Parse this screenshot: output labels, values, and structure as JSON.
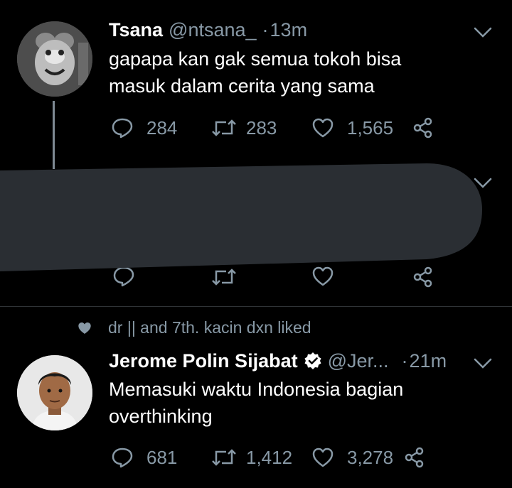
{
  "tweet1": {
    "name": "Tsana",
    "handle": "@ntsana_",
    "dot": "·",
    "time": "13m",
    "text_line1": "gapapa kan gak semua tokoh bisa",
    "text_line2": "masuk dalam cerita yang sama",
    "replies": "284",
    "retweets": "283",
    "likes": "1,565"
  },
  "tweet2": {
    "liked_by": "dr || and 7th. kacin dxn liked",
    "name": "Jerome Polin Sijabat",
    "handle": "@Jer...",
    "dot": "·",
    "time": "21m",
    "text_line1": "Memasuki waktu Indonesia bagian",
    "text_line2": "overthinking",
    "replies": "681",
    "retweets": "1,412",
    "likes": "3,278"
  },
  "colors": {
    "background": "#000000",
    "secondary_text": "#8899a6",
    "redaction": "#2a2e33"
  },
  "icons": [
    "reply-icon",
    "retweet-icon",
    "like-icon",
    "share-icon",
    "chevron-down-icon",
    "verified-badge-icon",
    "heart-filled-icon"
  ]
}
